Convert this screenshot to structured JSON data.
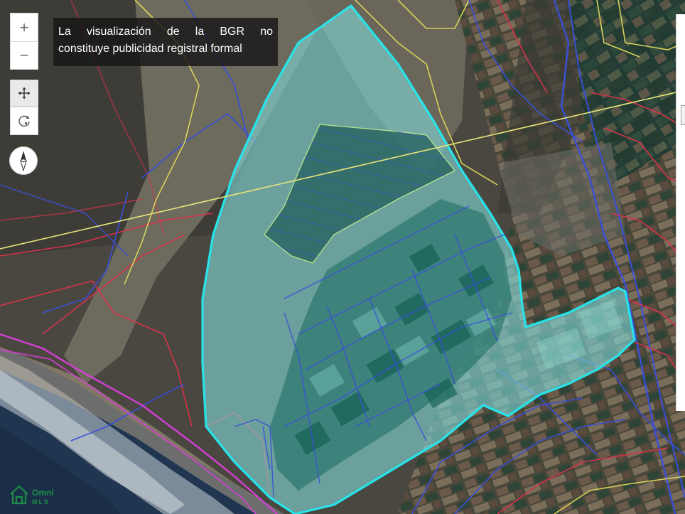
{
  "notice": {
    "line1": "La visualización de la BGR no",
    "line2": "constituye publicidad registral formal"
  },
  "controls": {
    "zoom_in": "+",
    "zoom_out": "−"
  },
  "icons": {
    "zoom_in": "plus-icon",
    "zoom_out": "minus-icon",
    "pan": "move-arrows-icon",
    "rotate": "rotate-icon",
    "compass": "compass-icon",
    "logo": "house-logo-icon"
  },
  "logo": {
    "text_top": "Omni",
    "text_bottom": "MLS"
  },
  "colors": {
    "selected_parcel_fill": "#7fd6d6",
    "selected_parcel_stroke": "#27e4ea",
    "parcel_blue": "#3a4fd8",
    "parcel_red": "#d8324a",
    "parcel_yellow": "#d8d25a",
    "coast_magenta": "#d63fd6",
    "logo_green": "#1e9e4a"
  }
}
